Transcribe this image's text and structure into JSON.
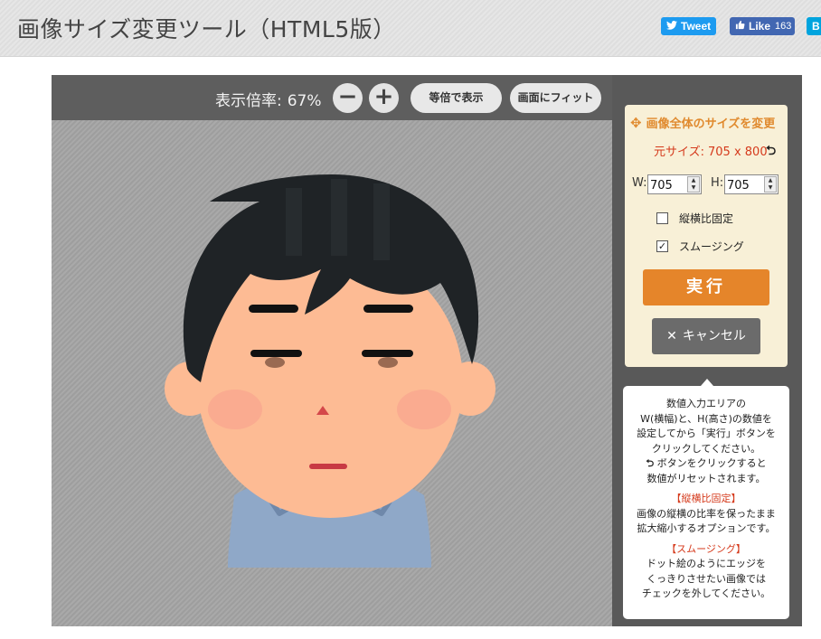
{
  "header": {
    "title": "画像サイズ変更ツール（HTML5版）",
    "tweet_label": "Tweet",
    "like_label": "Like",
    "like_count": "163",
    "hatena_label": "B"
  },
  "viewer": {
    "zoom_label": "表示倍率:",
    "zoom_value": "67%",
    "zoom_out_label": "−",
    "zoom_in_label": "+",
    "actual_size_label": "等倍で表示",
    "fit_screen_label": "画面にフィット"
  },
  "panel": {
    "title": "画像全体のサイズを変更",
    "original_size_label": "元サイズ:",
    "original_size_value": "705 x 800",
    "width_label": "W:",
    "width_value": "705",
    "height_label": "H:",
    "height_value": "705",
    "aspect_lock_label": "縦横比固定",
    "aspect_lock_checked": false,
    "smoothing_label": "スムージング",
    "smoothing_checked": true,
    "run_label": "実行",
    "cancel_label": "キャンセル"
  },
  "help": {
    "intro_1": "数値入力エリアの",
    "intro_2": "W(横幅)と、H(高さ)の数値を",
    "intro_3": "設定してから「実行」ボタンを",
    "intro_4": "クリックしてください。",
    "reset_1": "ボタンをクリックすると",
    "reset_2": "数値がリセットされます。",
    "aspect_head": "【縦横比固定】",
    "aspect_1": "画像の縦横の比率を保ったまま",
    "aspect_2": "拡大縮小するオプションです。",
    "smooth_head": "【スムージング】",
    "smooth_1": "ドット絵のようにエッジを",
    "smooth_2": "くっきりさせたい画像では",
    "smooth_3": "チェックを外してください。"
  },
  "colors": {
    "accent": "#e5852a",
    "warning": "#d53a1c",
    "panel_bg": "#f8f0d7"
  },
  "icons": {
    "move": "move-icon",
    "reset": "reset-icon",
    "cancel": "close-icon",
    "tweet": "twitter-bird-icon",
    "like": "thumbs-up-icon"
  }
}
